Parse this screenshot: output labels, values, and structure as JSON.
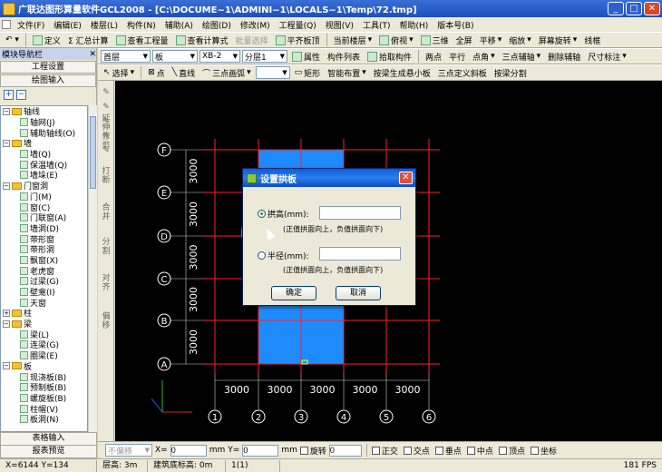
{
  "window": {
    "title": "广联达图形算量软件GCL2008 - [C:\\DOCUME~1\\ADMINI~1\\LOCALS~1\\Temp\\72.tmp]"
  },
  "menu": [
    "文件(F)",
    "编辑(E)",
    "楼层(L)",
    "构件(N)",
    "辅助(A)",
    "绘图(D)",
    "修改(M)",
    "工程量(Q)",
    "视图(V)",
    "工具(T)",
    "帮助(H)",
    "版本号(B)"
  ],
  "toolbar1": {
    "define": "定义",
    "sum": "Σ 汇总计算",
    "view_qty": "查看工程量",
    "view_formula": "查看计算式",
    "batch_select": "批量选择",
    "flat_slab": "平齐板顶",
    "current_floor": "当前楼层",
    "top_view": "俯视",
    "three_d": "三维",
    "fullscreen": "全屏",
    "pan": "平移",
    "zoom": "缩放",
    "screen_rotate": "屏幕旋转",
    "wireframe": "线框"
  },
  "toolbar2": {
    "floor_combo": "首层",
    "type_combo": "板",
    "name_combo": "XB-2",
    "layer_combo": "分层1",
    "attr": "属性",
    "comp_list": "构件列表",
    "pick": "拾取构件",
    "two_points": "两点",
    "parallel": "平行",
    "point_angle": "点角",
    "three_point_axis": "三点辅轴",
    "delete_axis": "删除辅轴",
    "dim": "尺寸标注"
  },
  "toolbar3": {
    "select": "选择",
    "point": "点",
    "line": "直线",
    "three_point_arc": "三点画弧",
    "rect": "矩形",
    "smart_layout": "智能布置",
    "gen_slab": "按梁生成悬小板",
    "three_point_slope": "三点定义斜板",
    "split_by_beam": "按梁分割"
  },
  "nav": {
    "title": "模块导航栏",
    "project_settings": "工程设置",
    "drawing_input": "绘图输入",
    "table_input": "表格输入",
    "report_preview": "报表预览",
    "tree": [
      {
        "label": "轴线",
        "type": "cat",
        "exp": "−"
      },
      {
        "label": "轴网(J)",
        "type": "leaf"
      },
      {
        "label": "辅助轴线(O)",
        "type": "leaf"
      },
      {
        "label": "墙",
        "type": "cat",
        "exp": "−"
      },
      {
        "label": "墙(Q)",
        "type": "leaf"
      },
      {
        "label": "保温墙(Q)",
        "type": "leaf"
      },
      {
        "label": "墙垛(E)",
        "type": "leaf"
      },
      {
        "label": "门窗洞",
        "type": "cat",
        "exp": "−"
      },
      {
        "label": "门(M)",
        "type": "leaf"
      },
      {
        "label": "窗(C)",
        "type": "leaf"
      },
      {
        "label": "门联窗(A)",
        "type": "leaf"
      },
      {
        "label": "墙洞(D)",
        "type": "leaf"
      },
      {
        "label": "带形窗",
        "type": "leaf"
      },
      {
        "label": "带形洞",
        "type": "leaf"
      },
      {
        "label": "飘窗(X)",
        "type": "leaf"
      },
      {
        "label": "老虎窗",
        "type": "leaf"
      },
      {
        "label": "过梁(G)",
        "type": "leaf"
      },
      {
        "label": "壁龛(I)",
        "type": "leaf"
      },
      {
        "label": "天窗",
        "type": "leaf"
      },
      {
        "label": "柱",
        "type": "cat",
        "exp": "+"
      },
      {
        "label": "梁",
        "type": "cat",
        "exp": "−"
      },
      {
        "label": "梁(L)",
        "type": "leaf"
      },
      {
        "label": "连梁(G)",
        "type": "leaf"
      },
      {
        "label": "圈梁(E)",
        "type": "leaf"
      },
      {
        "label": "板",
        "type": "cat",
        "exp": "−"
      },
      {
        "label": "现浇板(B)",
        "type": "leaf"
      },
      {
        "label": "预制板(B)",
        "type": "leaf"
      },
      {
        "label": "螺旋板(B)",
        "type": "leaf"
      },
      {
        "label": "柱帽(V)",
        "type": "leaf"
      },
      {
        "label": "板洞(N)",
        "type": "leaf"
      }
    ]
  },
  "side_strip": [
    "延伸",
    "修剪",
    "打断",
    "合并",
    "分割",
    "对齐",
    "偏移"
  ],
  "drawing": {
    "row_axes": [
      "F",
      "E",
      "D",
      "C",
      "B",
      "A"
    ],
    "col_axes": [
      "1",
      "2",
      "3",
      "4",
      "5",
      "6"
    ],
    "row_spacing": [
      "3000",
      "3000",
      "3000",
      "3000",
      "3000"
    ],
    "col_spacing": [
      "3000",
      "3000",
      "3000",
      "3000",
      "3000"
    ],
    "axis_color": "#ffffff",
    "grid_color": "#ff2020",
    "slab_color": "#1e8cff"
  },
  "dialog": {
    "title": "设置拱板",
    "arch_height_label": "拱高(mm):",
    "arch_height_value": "",
    "arch_note": "(正值拱面向上，负值拱面向下)",
    "radius_label": "半径(mm):",
    "radius_value": "",
    "radius_note": "(正值拱面向上，负值拱面向下)",
    "ok": "确定",
    "cancel": "取消",
    "selected": "arch_height"
  },
  "statusbar2": {
    "no_offset": "不偏移",
    "x_label": "X=",
    "x_val": "0",
    "y_label": "Y=",
    "y_val": "0",
    "unit": "mm",
    "rotate": "旋转",
    "rot_val": "0",
    "snaps": [
      "正交",
      "交点",
      "垂点",
      "中点",
      "顶点",
      "坐标"
    ]
  },
  "statusbar": {
    "coords": "X=6144 Y=134",
    "floor_height": "层高: 3m",
    "base_elev": "建筑底标高: 0m",
    "page": "1(1)",
    "fps": "181 FPS"
  }
}
